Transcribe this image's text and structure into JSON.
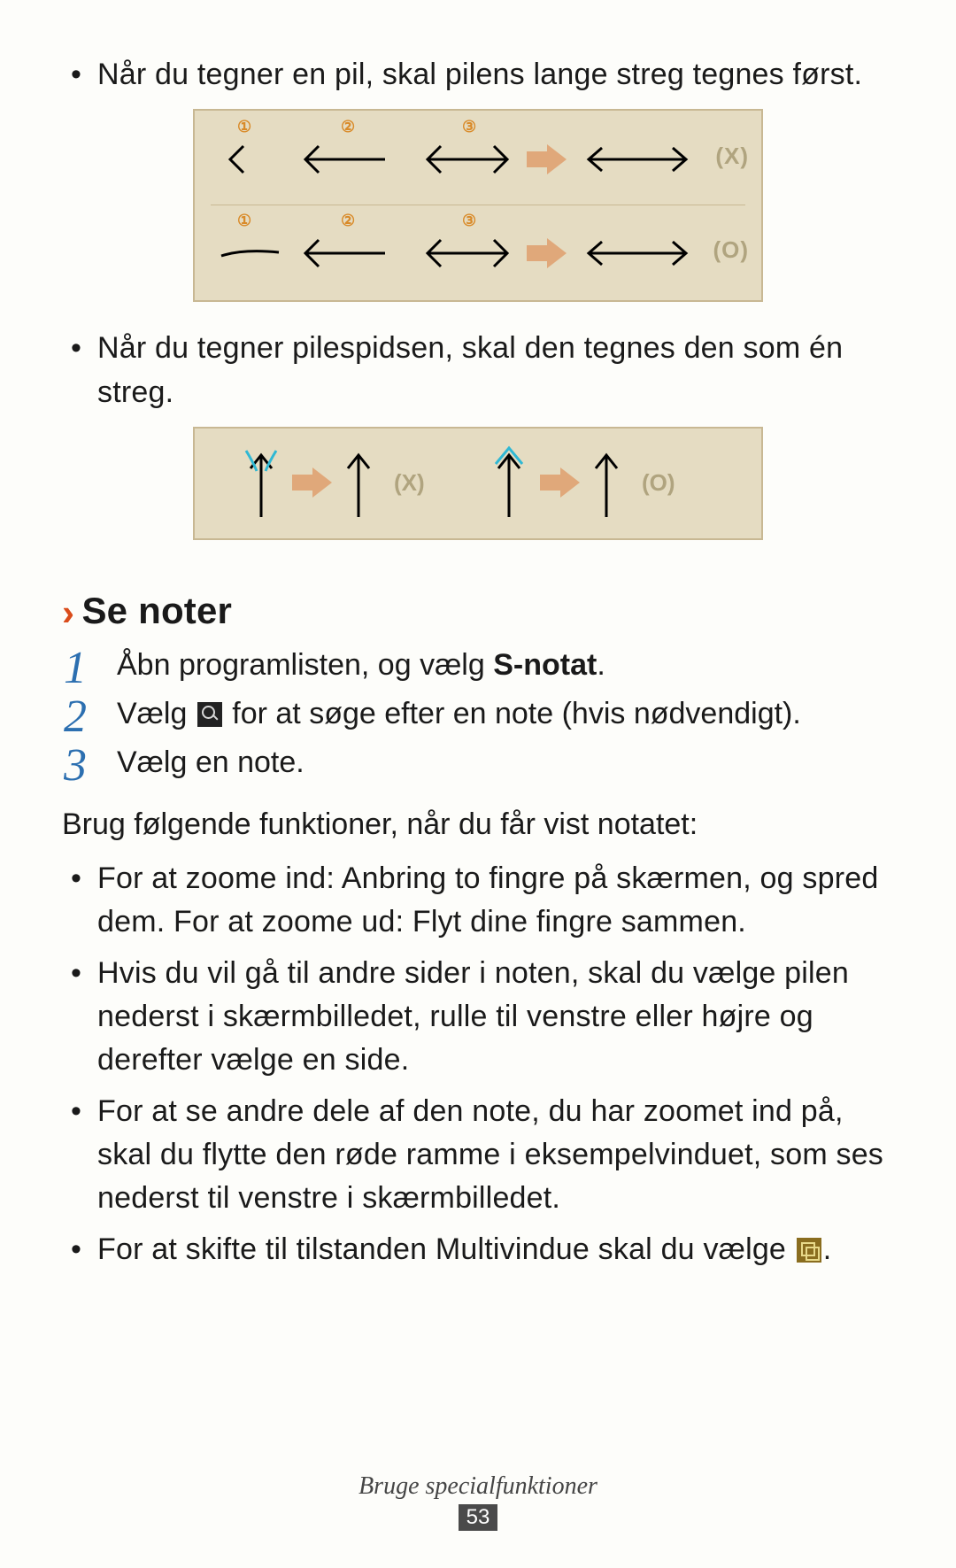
{
  "intro_bullets": [
    "Når du tegner en pil, skal pilens lange streg tegnes først.",
    "Når du tegner pilespidsen, skal den tegnes den som én streg."
  ],
  "illuA": {
    "step_labels": [
      "①",
      "②",
      "③"
    ],
    "wrong": "(X)",
    "correct": "(O)"
  },
  "illuB": {
    "wrong": "(X)",
    "correct": "(O)"
  },
  "section": {
    "chevron": "›",
    "title": "Se noter"
  },
  "steps": [
    {
      "num": "1",
      "pre": "Åbn programlisten, og vælg ",
      "bold": "S-notat",
      "post": "."
    },
    {
      "num": "2",
      "pre": "Vælg ",
      "icon": "search",
      "post": " for at søge efter en note (hvis nødvendigt)."
    },
    {
      "num": "3",
      "pre": "Vælg en note."
    }
  ],
  "para": "Brug følgende funktioner, når du får vist notatet:",
  "sub_bullets": [
    "For at zoome ind: Anbring to fingre på skærmen, og spred dem. For at zoome ud: Flyt dine fingre sammen.",
    "Hvis du vil gå til andre sider i noten, skal du vælge pilen nederst i skærmbilledet, rulle til venstre eller højre og derefter vælge en side.",
    "For at se andre dele af den note, du har zoomet ind på, skal du flytte den røde ramme i eksempelvinduet, som ses nederst til venstre i skærmbilledet."
  ],
  "last_bullet": {
    "pre": "For at skifte til tilstanden Multivindue skal du vælge ",
    "icon": "multi",
    "post": "."
  },
  "footer": {
    "section": "Bruge specialfunktioner",
    "page": "53"
  }
}
